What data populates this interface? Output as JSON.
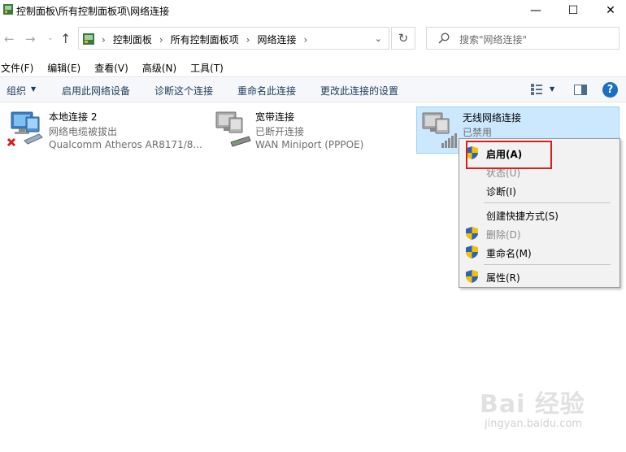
{
  "window": {
    "title": "控制面板\\所有控制面板项\\网络连接",
    "controls": {
      "minimize": "—",
      "maximize": "☐",
      "close": "✕"
    }
  },
  "nav": {
    "back": "←",
    "forward": "→",
    "recent": "⌄",
    "up": "↑",
    "breadcrumb": [
      "控制面板",
      "所有控制面板项",
      "网络连接"
    ],
    "separator": "›",
    "dropdown": "⌄",
    "refresh": "↻",
    "search_placeholder": "搜索\"网络连接\""
  },
  "menu": [
    "文件(F)",
    "编辑(E)",
    "查看(V)",
    "高级(N)",
    "工具(T)"
  ],
  "commands": {
    "organize": "组织",
    "organize_arrow": "▼",
    "enable": "启用此网络设备",
    "diagnose": "诊断这个连接",
    "rename": "重命名此连接",
    "change_settings": "更改此连接的设置",
    "view_arrow": "▼",
    "help": "?"
  },
  "connections": [
    {
      "name": "本地连接 2",
      "status": "网络电缆被拔出",
      "device": "Qualcomm Atheros AR8171/8...",
      "icon": "ethernet-unplugged-icon"
    },
    {
      "name": "宽带连接",
      "status": "已断开连接",
      "device": "WAN Miniport (PPPOE)",
      "icon": "broadband-modem-icon"
    },
    {
      "name": "无线网络连接",
      "status": "已禁用",
      "device": "",
      "icon": "wireless-disabled-icon",
      "selected": true
    }
  ],
  "context_menu": {
    "items": [
      {
        "label": "启用(A)",
        "shield": true,
        "bold": true,
        "disabled": false
      },
      {
        "label": "状态(U)",
        "shield": false,
        "bold": false,
        "disabled": true
      },
      {
        "label": "诊断(I)",
        "shield": false,
        "bold": false,
        "disabled": false
      },
      {
        "label": "创建快捷方式(S)",
        "shield": false,
        "bold": false,
        "disabled": false
      },
      {
        "label": "删除(D)",
        "shield": true,
        "bold": false,
        "disabled": true
      },
      {
        "label": "重命名(M)",
        "shield": true,
        "bold": false,
        "disabled": false
      },
      {
        "label": "属性(R)",
        "shield": true,
        "bold": false,
        "disabled": false
      }
    ]
  },
  "watermark": {
    "brand": "Bai 经验",
    "url": "jingyan.baidu.com"
  },
  "colors": {
    "selection": "#cce8ff",
    "highlight_border": "#d9201f",
    "command_text": "#1e395b",
    "help_blue": "#1a6fc4"
  }
}
